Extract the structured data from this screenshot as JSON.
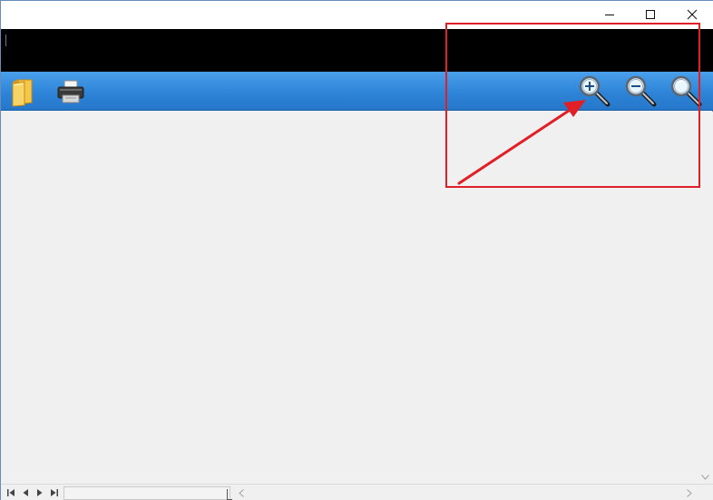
{
  "window": {
    "titlebar": {
      "minimize": {
        "icon": "minimize-icon"
      },
      "maximize": {
        "icon": "maximize-icon"
      },
      "close": {
        "icon": "close-icon"
      }
    }
  },
  "toolbar": {
    "buttons": [
      {
        "id": "open",
        "icon": "folder-icon"
      },
      {
        "id": "print",
        "icon": "printer-icon"
      },
      {
        "id": "zoom-in",
        "icon": "zoom-in-icon"
      },
      {
        "id": "zoom-out",
        "icon": "zoom-out-icon"
      },
      {
        "id": "zoom-fit",
        "icon": "magnifier-icon"
      }
    ]
  },
  "navigation": {
    "buttons": [
      "first-page-icon",
      "previous-page-icon",
      "next-page-icon",
      "last-page-icon"
    ],
    "page_value": ""
  },
  "annotation": {
    "color": "#e01f26",
    "target": "zoom-in-button"
  },
  "colors": {
    "toolbar": "#2e84d8",
    "content": "#f0f0f0",
    "blackbar": "#000000"
  }
}
